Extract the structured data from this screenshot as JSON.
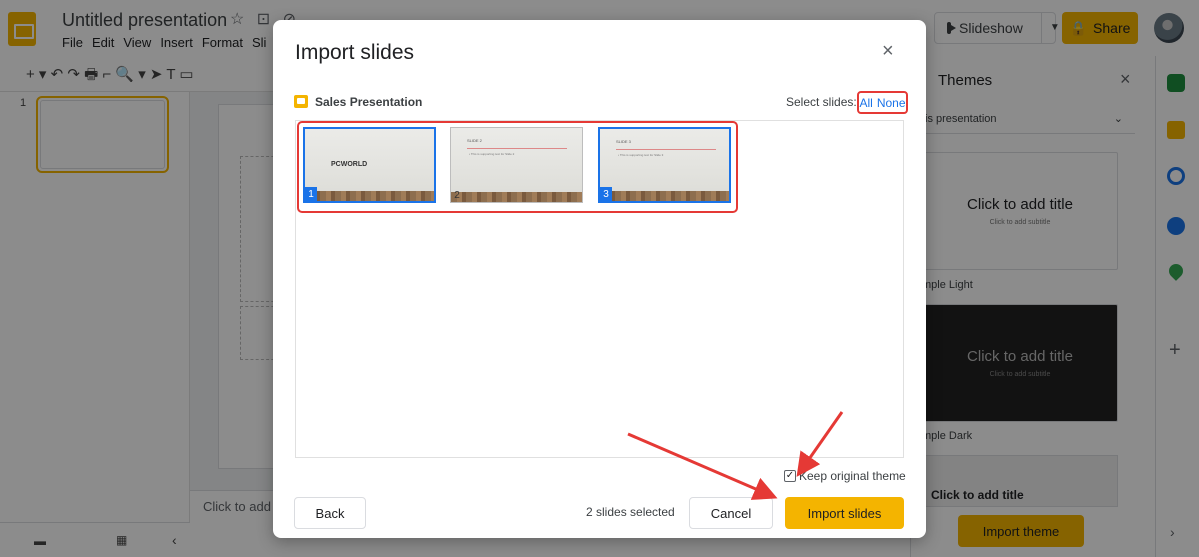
{
  "app": {
    "title": "Untitled presentation",
    "title_icons": "☆ ⊡ ⊘",
    "menu": [
      "File",
      "Edit",
      "View",
      "Insert",
      "Format",
      "Sli"
    ],
    "slideshow_label": "Slideshow",
    "share_label": "Share",
    "toolbar_icons": "+ ▾  ↶  ↷  🖶  ⌐  🔍 ▾  ➤  T  ▭",
    "filmstrip_number": "1",
    "notes_placeholder": "Click to add"
  },
  "themes": {
    "title": "Themes",
    "dropdown_label": "is presentation",
    "cards": [
      {
        "title": "Click to add title",
        "subtitle": "Click to add subtitle",
        "label": "mple Light"
      },
      {
        "title": "Click to add title",
        "subtitle": "Click to add subtitle",
        "label": "mple Dark"
      }
    ],
    "third_card_title": "Click to add title",
    "import_theme_label": "Import theme"
  },
  "dialog": {
    "title": "Import slides",
    "close_icon": "×",
    "source_name": "Sales Presentation",
    "select_label": "Select slides:",
    "select_all": "All",
    "select_none": "None",
    "slides": [
      {
        "number": "1",
        "selected": true,
        "content": "PCWORLD"
      },
      {
        "number": "2",
        "selected": false,
        "heading": "SLIDE 2",
        "bullet": "• This is supporting text for Slide 2"
      },
      {
        "number": "3",
        "selected": true,
        "heading": "SLIDE 3",
        "bullet": "• This is supporting text for Slide 3"
      }
    ],
    "keep_theme_label": "Keep original theme",
    "keep_theme_checked": true,
    "back_label": "Back",
    "selected_count": "2 slides selected",
    "cancel_label": "Cancel",
    "import_label": "Import slides"
  },
  "colors": {
    "accent": "#f4b400",
    "selection": "#1a73e8",
    "highlight": "#e53935"
  }
}
